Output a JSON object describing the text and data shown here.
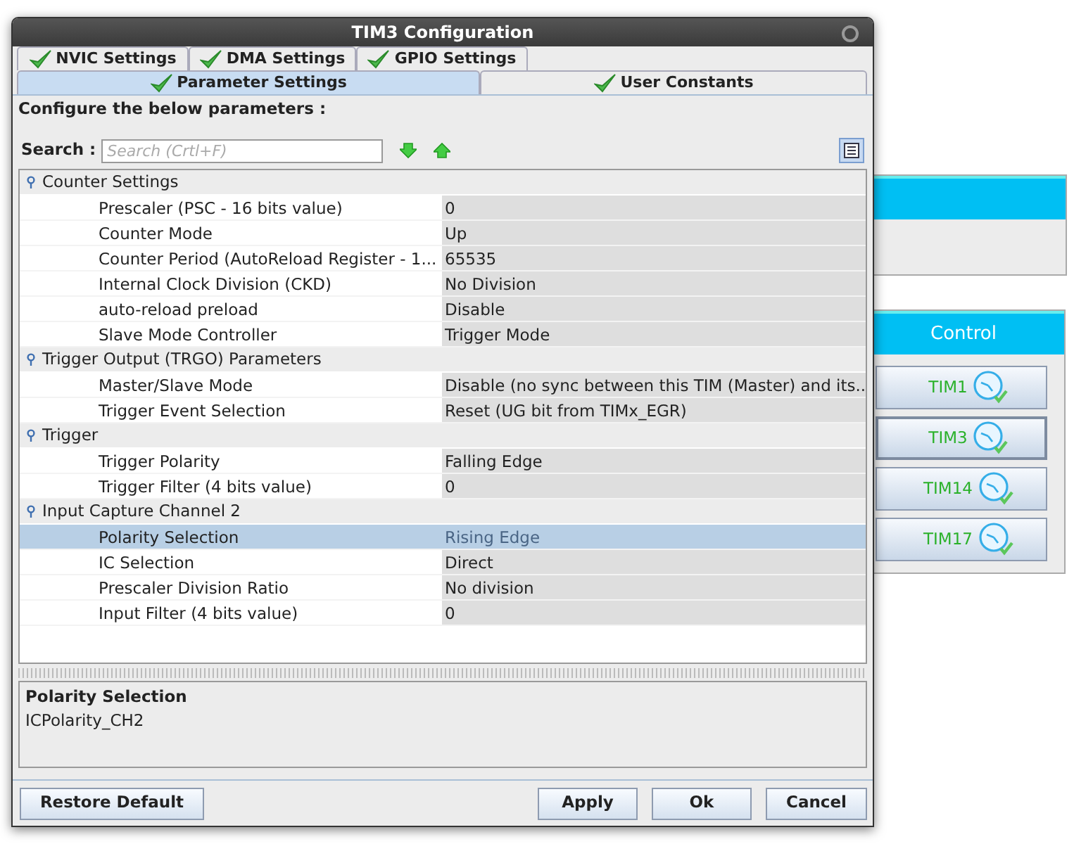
{
  "window": {
    "title": "TIM3 Configuration"
  },
  "tabs": [
    [
      {
        "label": "NVIC Settings",
        "selected": false
      },
      {
        "label": "DMA Settings",
        "selected": false
      },
      {
        "label": "GPIO Settings",
        "selected": false
      }
    ],
    [
      {
        "label": "Parameter Settings",
        "selected": true
      },
      {
        "label": "User Constants",
        "selected": false
      }
    ]
  ],
  "heading": "Configure the below parameters :",
  "search": {
    "label": "Search :",
    "placeholder": "Search (Crtl+F)"
  },
  "tree": [
    {
      "label": "Counter Settings",
      "children": [
        {
          "name": "Prescaler (PSC - 16 bits value)",
          "value": "0",
          "selected": false
        },
        {
          "name": "Counter Mode",
          "value": "Up",
          "selected": false
        },
        {
          "name": "Counter Period (AutoReload Register - 1...",
          "value": "65535",
          "selected": false
        },
        {
          "name": "Internal Clock Division (CKD)",
          "value": "No Division",
          "selected": false
        },
        {
          "name": "auto-reload preload",
          "value": "Disable",
          "selected": false
        },
        {
          "name": "Slave Mode Controller",
          "value": "Trigger Mode",
          "selected": false
        }
      ]
    },
    {
      "label": "Trigger Output (TRGO) Parameters",
      "children": [
        {
          "name": "Master/Slave Mode",
          "value": "Disable (no sync between this TIM (Master) and its...",
          "selected": false
        },
        {
          "name": "Trigger Event Selection",
          "value": "Reset (UG bit from TIMx_EGR)",
          "selected": false
        }
      ]
    },
    {
      "label": "Trigger",
      "children": [
        {
          "name": "Trigger Polarity",
          "value": "Falling Edge",
          "selected": false
        },
        {
          "name": "Trigger Filter (4 bits value)",
          "value": "0",
          "selected": false
        }
      ]
    },
    {
      "label": "Input Capture Channel 2",
      "children": [
        {
          "name": "Polarity Selection",
          "value": "Rising Edge",
          "selected": true
        },
        {
          "name": "IC Selection",
          "value": "Direct",
          "selected": false
        },
        {
          "name": "Prescaler Division Ratio",
          "value": "No division",
          "selected": false
        },
        {
          "name": "Input Filter (4 bits value)",
          "value": "0",
          "selected": false
        }
      ]
    }
  ],
  "description": {
    "title": "Polarity Selection",
    "text": "ICPolarity_CH2"
  },
  "buttons": {
    "left": [
      "Restore Default"
    ],
    "right": [
      "Apply",
      "Ok",
      "Cancel"
    ]
  },
  "control_panel": {
    "title": "Control",
    "timers": [
      {
        "label": "TIM1",
        "selected": false
      },
      {
        "label": "TIM3",
        "selected": true
      },
      {
        "label": "TIM14",
        "selected": false
      },
      {
        "label": "TIM17",
        "selected": false
      }
    ]
  }
}
